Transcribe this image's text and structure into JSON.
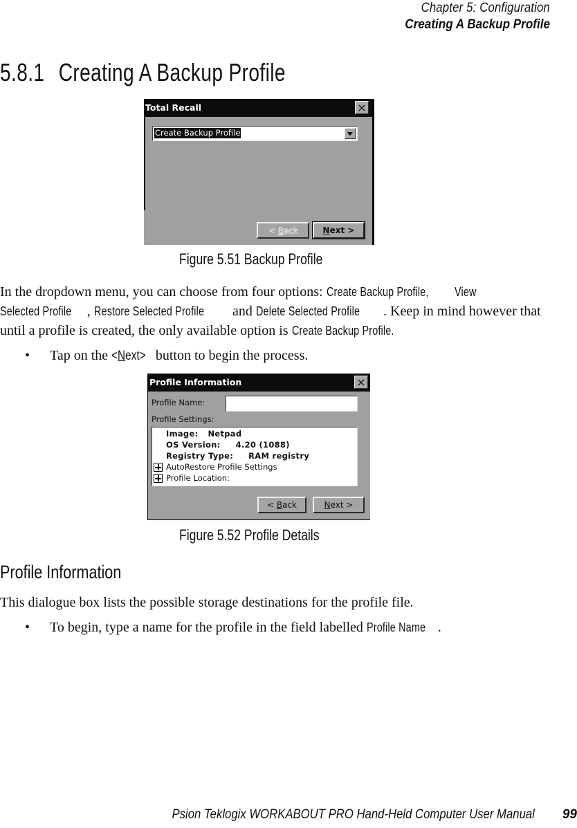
{
  "running_header": {
    "chapter": "Chapter  5:  Configuration",
    "section": "Creating A Backup Profile"
  },
  "section_heading": {
    "number": "5.8.1",
    "title": "Creating A Backup Profile"
  },
  "figure1": {
    "window_title": "Total Recall",
    "close_glyph": "×",
    "dropdown": {
      "selected_value": "Create Backup Profile"
    },
    "buttons": {
      "back": {
        "prefix": "< ",
        "mnemonic": "B",
        "rest": "ack",
        "enabled": false
      },
      "next": {
        "mnemonic": "N",
        "rest": "ext >",
        "enabled": true
      }
    },
    "caption": "Figure  5.51  Backup  Profile"
  },
  "paragraph1": {
    "t1": "In the dropdown menu, you can choose from four options: ",
    "opt1": "Create Backup Profile,",
    "opt2a": "View",
    "opt2b": "Selected Profile",
    "t2": ", ",
    "opt3": "Restore Selected Profile",
    "t3": " and ",
    "opt4": "Delete Selected Profile",
    "t4": ". Keep in mind however that",
    "t5": "until a profile is created, the only available option is ",
    "opt5": "Create Backup Profile."
  },
  "bullet1": {
    "bullet": "•",
    "t1": "Tap on the ",
    "key_open": "<",
    "key_mnemonic": "N",
    "key_rest": "ext>",
    "t2": " button to begin the process."
  },
  "figure2": {
    "window_title": "Profile Information",
    "close_glyph": "×",
    "profile_name_label": "Profile Name:",
    "profile_name_value": "",
    "profile_settings_label": "Profile Settings:",
    "tree": [
      {
        "label": "Image:",
        "value": "Netpad",
        "bold": true
      },
      {
        "label": "OS Version:",
        "value": "4.20 (1088)",
        "bold": true
      },
      {
        "label": "Registry Type:",
        "value": "RAM registry",
        "bold": true
      },
      {
        "label": "AutoRestore Profile Settings",
        "expandable": true
      },
      {
        "label": "Profile Location:",
        "expandable": true
      }
    ],
    "buttons": {
      "back": {
        "prefix": "< ",
        "mnemonic": "B",
        "rest": "ack",
        "enabled": true
      },
      "next": {
        "mnemonic": "N",
        "rest": "ext >",
        "enabled": true
      }
    },
    "caption": "Figure  5.52  Profile  Details"
  },
  "subheading": "Profile  Information",
  "paragraph2": "This dialogue box lists the possible storage destinations for the profile file.",
  "bullet2": {
    "bullet": "•",
    "t1": "To begin, type a name for the profile in the field labelled ",
    "term": "Profile Name",
    "t2": "."
  },
  "footer": {
    "title": "Psion Teklogix WORKABOUT PRO Hand-Held Computer User Manual",
    "page": "99"
  }
}
